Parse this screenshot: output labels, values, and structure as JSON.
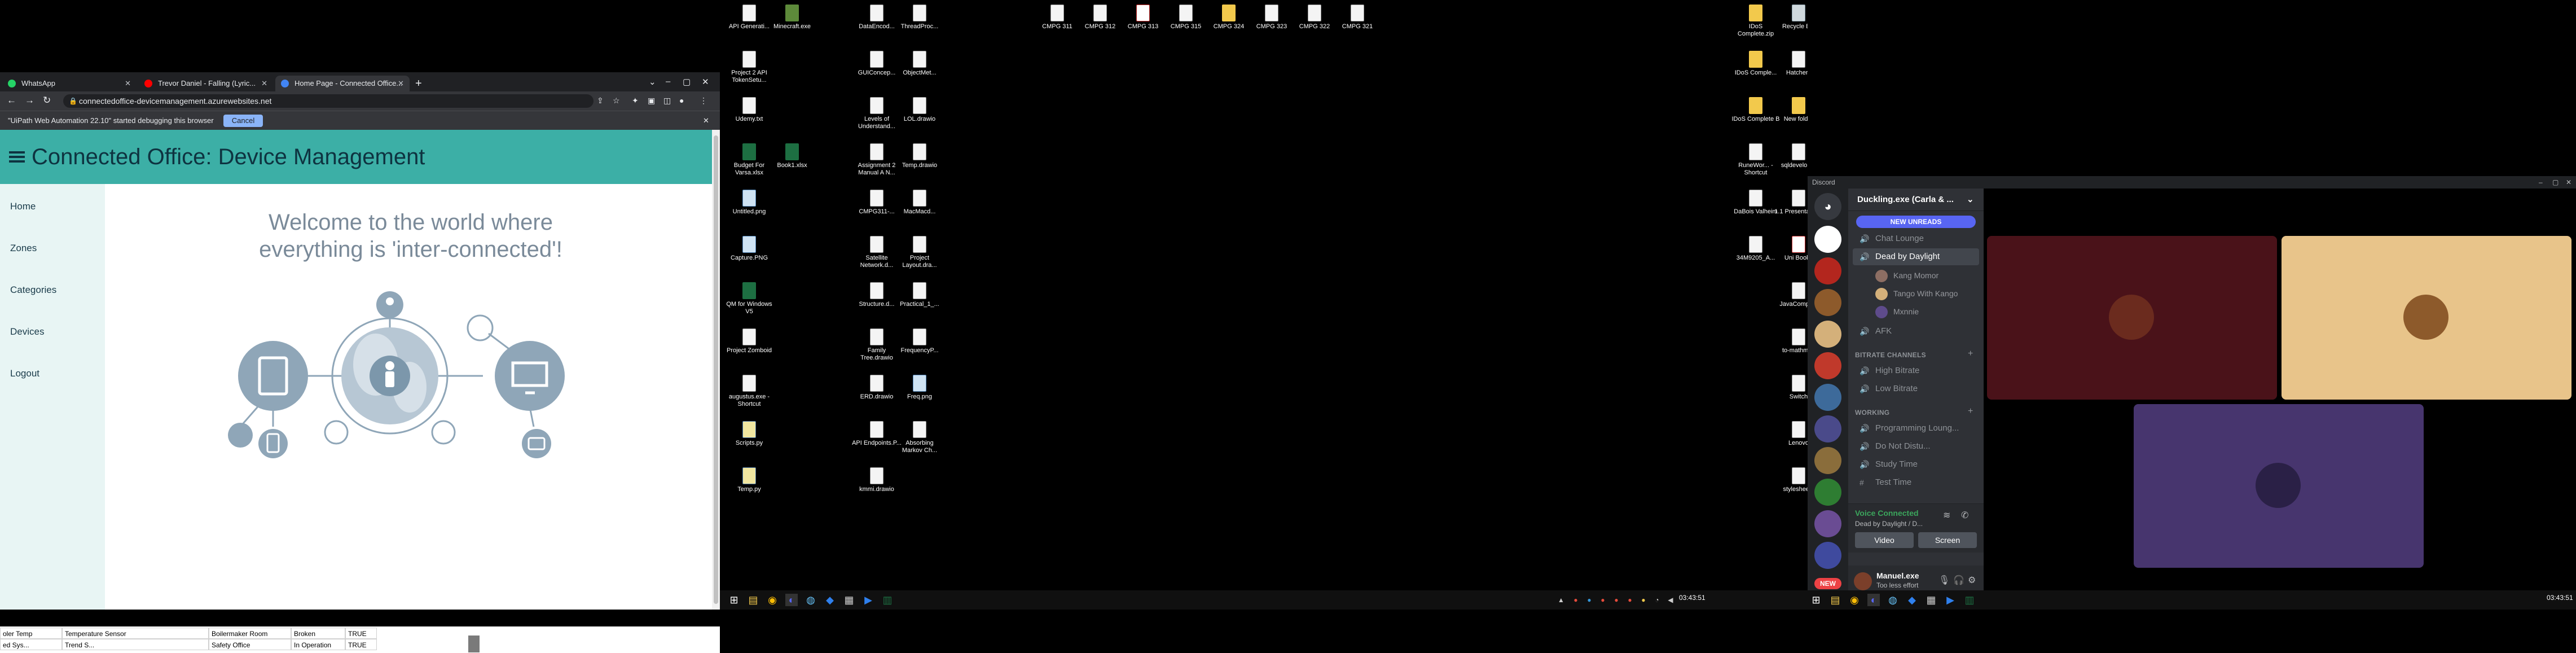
{
  "chrome": {
    "tabs": [
      {
        "title": "WhatsApp",
        "fav_color": "#25d366"
      },
      {
        "title": "Trevor Daniel - Falling (Lyric...",
        "fav_color": "#ff0000"
      },
      {
        "title": "Home Page - Connected Office...",
        "fav_color": "#4285f4"
      }
    ],
    "url": "connectedoffice-devicemanagement.azurewebsites.net",
    "infobar_text": "\"UiPath Web Automation 22.10\" started debugging this browser",
    "cancel_label": "Cancel"
  },
  "site": {
    "title": "Connected Office: Device Management",
    "nav": [
      "Home",
      "Zones",
      "Categories",
      "Devices",
      "Logout"
    ],
    "welcome_line1": "Welcome to the world where",
    "welcome_line2": "everything is 'inter-connected'!"
  },
  "excel": {
    "row1": [
      "oler Temp",
      "Temperature Sensor",
      "Boilermaker Room",
      "Broken",
      "TRUE"
    ],
    "row2": [
      "ed Sys...",
      "Trend S...",
      "Safety Office",
      "In Operation",
      "TRUE"
    ]
  },
  "desktop": {
    "icons": [
      {
        "label": "API Generati...",
        "type": "file"
      },
      {
        "label": "Minecraft.exe",
        "type": "mc"
      },
      {
        "label": "DataEncod...",
        "type": "file"
      },
      {
        "label": "ThreadProc...",
        "type": "file"
      },
      {
        "label": "CMPG 311",
        "type": "file"
      },
      {
        "label": "CMPG 312",
        "type": "file"
      },
      {
        "label": "CMPG 313",
        "type": "pdf"
      },
      {
        "label": "CMPG 315",
        "type": "file"
      },
      {
        "label": "CMPG 324",
        "type": "folder"
      },
      {
        "label": "CMPG 323",
        "type": "file"
      },
      {
        "label": "CMPG 322",
        "type": "file"
      },
      {
        "label": "CMPG 321",
        "type": "file"
      },
      {
        "label": "Project 2 API TokenSetu...",
        "type": "file"
      },
      {
        "label": "GUIConcep...",
        "type": "file"
      },
      {
        "label": "ObjectMet...",
        "type": "file"
      },
      {
        "label": "Udemy.txt",
        "type": "file"
      },
      {
        "label": "Levels of Understand...",
        "type": "file"
      },
      {
        "label": "LOL.drawio",
        "type": "file"
      },
      {
        "label": "Budget For Varsa.xlsx",
        "type": "excel"
      },
      {
        "label": "Book1.xlsx",
        "type": "excel"
      },
      {
        "label": "Assignment 2 Manual A N...",
        "type": "file"
      },
      {
        "label": "Temp.drawio",
        "type": "file"
      },
      {
        "label": "Untitled.png",
        "type": "pic"
      },
      {
        "label": "CMPG311-...",
        "type": "file"
      },
      {
        "label": "MacMacd...",
        "type": "file"
      },
      {
        "label": "Capture.PNG",
        "type": "pic"
      },
      {
        "label": "Satellite Network.d...",
        "type": "file"
      },
      {
        "label": "Project Layout.dra...",
        "type": "file"
      },
      {
        "label": "QM for Windows V5",
        "type": "excel"
      },
      {
        "label": "Structure.d...",
        "type": "file"
      },
      {
        "label": "Practical_1_...",
        "type": "file"
      },
      {
        "label": "Project Zomboid",
        "type": "file"
      },
      {
        "label": "Family Tree.drawio",
        "type": "file"
      },
      {
        "label": "FrequencyP...",
        "type": "file"
      },
      {
        "label": "augustus.exe - Shortcut",
        "type": "file"
      },
      {
        "label": "ERD.drawio",
        "type": "file"
      },
      {
        "label": "Freq.png",
        "type": "pic"
      },
      {
        "label": "Scripts.py",
        "type": "py"
      },
      {
        "label": "API Endpoints.P...",
        "type": "file"
      },
      {
        "label": "Absorbing Markov Ch...",
        "type": "file"
      },
      {
        "label": "Temp.py",
        "type": "py"
      },
      {
        "label": "kmmi.drawio",
        "type": "file"
      },
      {
        "label": "IDoS Complete.zip",
        "type": "folder"
      },
      {
        "label": "Recycle Bin",
        "type": "bin"
      },
      {
        "label": "IDoS Comple...",
        "type": "folder"
      },
      {
        "label": "Hatchery",
        "type": "file"
      },
      {
        "label": "IDoS Complete B",
        "type": "folder"
      },
      {
        "label": "New folder",
        "type": "folder"
      },
      {
        "label": "RuneWor... - Shortcut",
        "type": "file"
      },
      {
        "label": "sqldeveloper",
        "type": "file"
      },
      {
        "label": "DaBois Valheim",
        "type": "file"
      },
      {
        "label": "1.1 Presentations",
        "type": "file"
      },
      {
        "label": "34M9205_A...",
        "type": "file"
      },
      {
        "label": "Uni Books",
        "type": "pdf"
      },
      {
        "label": "JavaCompiler",
        "type": "file"
      },
      {
        "label": "to-mathml...",
        "type": "file"
      },
      {
        "label": "Switch",
        "type": "file"
      },
      {
        "label": "Lenovo",
        "type": "file"
      },
      {
        "label": "stylesheets",
        "type": "file"
      }
    ],
    "clock": "03:43:51"
  },
  "discord": {
    "app_title": "Discord",
    "server_name": "Duckling.exe (Carla & ...",
    "new_unreads": "NEW UNREADS",
    "channels": {
      "chat_lounge": "Chat Lounge",
      "dead_by_daylight": "Dead by Daylight",
      "members": [
        "Kang Momor",
        "Tango With Kango",
        "Mxnnie"
      ],
      "afk": "AFK",
      "bitrate_category": "BITRATE CHANNELS",
      "high_bitrate": "High Bitrate",
      "low_bitrate": "Low Bitrate",
      "working_category": "WORKING",
      "programming": "Programming Loung...",
      "do_not_disturb": "Do Not Distu...",
      "study_time": "Study Time",
      "test_time": "Test Time"
    },
    "voice": {
      "status": "Voice Connected",
      "channel": "Dead by Daylight / D...",
      "video_label": "Video",
      "screen_label": "Screen"
    },
    "user": {
      "name": "Manuel.exe",
      "status": "Too less effort"
    },
    "new_badge": "NEW",
    "clock": "03:43:51"
  }
}
